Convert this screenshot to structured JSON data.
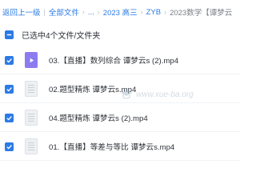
{
  "breadcrumb": {
    "back": "返回上一级",
    "all_files": "全部文件",
    "ellipsis": "...",
    "folder_2023": "2023 高三",
    "folder_zyb": "ZYB",
    "current": "2023数学【谭梦云"
  },
  "selection": {
    "summary": "已选中4个文件/文件夹"
  },
  "files": [
    {
      "name": "03.【直播】数列综合 谭梦云s (2).mp4",
      "type": "video",
      "selected": true
    },
    {
      "name": "02.题型精炼 谭梦云s.mp4",
      "type": "document",
      "selected": true
    },
    {
      "name": "04.题型精炼 谭梦云s (2).mp4",
      "type": "document",
      "selected": true
    },
    {
      "name": "01.【直播】等差与等比 谭梦云s.mp4",
      "type": "document",
      "selected": true
    }
  ],
  "watermark": {
    "text": "www.xue-ba.org"
  },
  "colors": {
    "accent": "#2c7be5",
    "video_thumb": "#8c7cf0"
  }
}
